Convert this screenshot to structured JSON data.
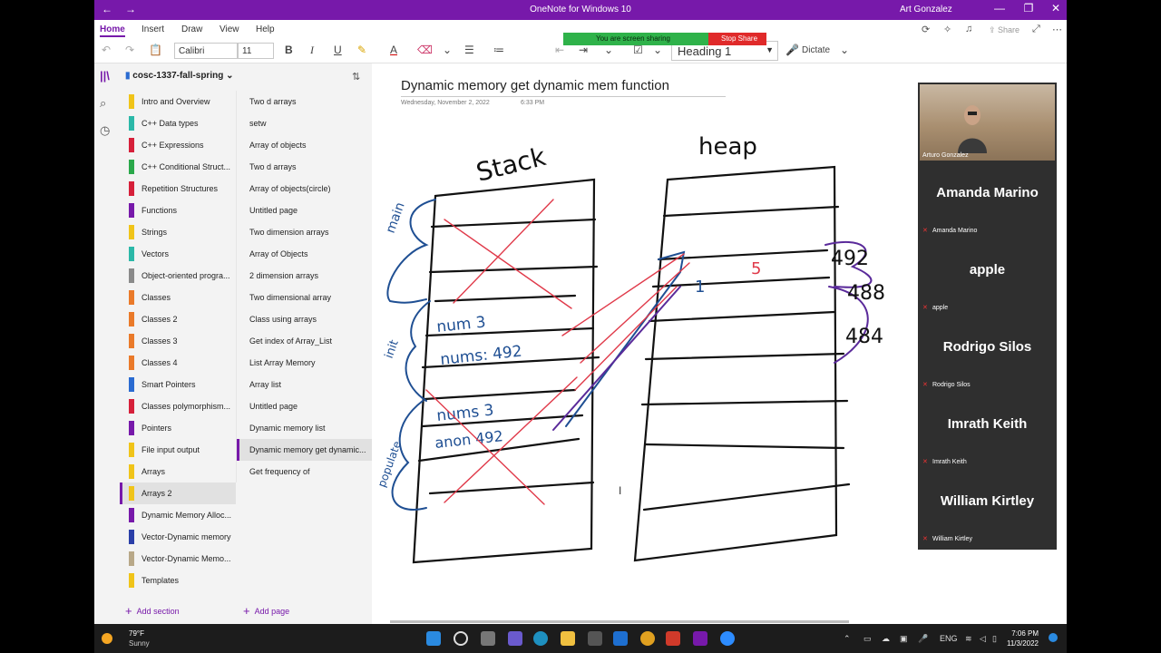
{
  "window": {
    "title": "OneNote for Windows 10",
    "user": "Art Gonzalez",
    "back_glyph": "←",
    "forward_glyph": "→",
    "minimize_glyph": "—",
    "restore_glyph": "❐",
    "close_glyph": "✕"
  },
  "menu": {
    "tabs": [
      "Home",
      "Insert",
      "Draw",
      "View",
      "Help"
    ],
    "active_tab": "Home",
    "share_label": "Share"
  },
  "ribbon": {
    "font_name": "Calibri",
    "font_size": "11",
    "style": "Heading 1",
    "dictate_label": "Dictate"
  },
  "screen_share": {
    "status": "You are screen sharing",
    "stop_label": "Stop Share"
  },
  "notebook": {
    "name": "cosc-1337-fall-spring",
    "sections": [
      {
        "label": "Intro and Overview",
        "color": "#f0c419"
      },
      {
        "label": "C++ Data types",
        "color": "#2bb8a8"
      },
      {
        "label": "C++ Expressions",
        "color": "#d6203a"
      },
      {
        "label": "C++ Conditional Struct...",
        "color": "#2aa84a"
      },
      {
        "label": "Repetition Structures",
        "color": "#d6203a"
      },
      {
        "label": "Functions",
        "color": "#7719aa"
      },
      {
        "label": "Strings",
        "color": "#f0c419"
      },
      {
        "label": "Vectors",
        "color": "#2bb8a8"
      },
      {
        "label": "Object-oriented progra...",
        "color": "#8a8a8a"
      },
      {
        "label": "Classes",
        "color": "#ea7a2a"
      },
      {
        "label": "Classes 2",
        "color": "#ea7a2a"
      },
      {
        "label": "Classes 3",
        "color": "#ea7a2a"
      },
      {
        "label": "Classes 4",
        "color": "#ea7a2a"
      },
      {
        "label": "Smart Pointers",
        "color": "#2a6bd1"
      },
      {
        "label": "Classes polymorphism...",
        "color": "#d6203a"
      },
      {
        "label": "Pointers",
        "color": "#7719aa"
      },
      {
        "label": "File input output",
        "color": "#f0c419"
      },
      {
        "label": "Arrays",
        "color": "#f0c419"
      },
      {
        "label": "Arrays 2",
        "color": "#f0c419"
      },
      {
        "label": "Dynamic Memory Alloc...",
        "color": "#7719aa"
      },
      {
        "label": "Vector-Dynamic memory",
        "color": "#2a3fa8"
      },
      {
        "label": "Vector-Dynamic Memo...",
        "color": "#b8a888"
      },
      {
        "label": "Templates",
        "color": "#f0c419"
      }
    ],
    "selected_section": "Arrays 2",
    "pages": [
      "Two  d arrays",
      "setw",
      "Array of objects",
      "Two d arrays",
      "Array of objects(circle)",
      "Untitled page",
      "Two dimension arrays",
      "Array of Objects",
      "2 dimension arrays",
      "Two dimensional array",
      "Class using arrays",
      "Get index of Array_List",
      "List Array Memory",
      "Array list",
      "Untitled page",
      "Dynamic memory list",
      "Dynamic memory get dynamic...",
      "Get frequency of"
    ],
    "selected_page": "Dynamic memory get dynamic...",
    "add_section_label": "Add section",
    "add_page_label": "Add page"
  },
  "page": {
    "title": "Dynamic memory get dynamic mem function",
    "date": "Wednesday, November 2, 2022",
    "time": "6:33 PM"
  },
  "ink_text": {
    "stack": "Stack",
    "heap": "heap",
    "main": "main",
    "init": "init",
    "populate": "populate",
    "num3": "num 3",
    "nums492": "nums: 492",
    "nums3": "nums 3",
    "anon492": "anon 492",
    "h1": "1",
    "h5": "5",
    "a492": "492",
    "a488": "488",
    "a484": "484"
  },
  "participants": {
    "self_name": "Arturo Gonzalez",
    "others": [
      "Amanda Marino",
      "apple",
      "Rodrigo Silos",
      "Imrath Keith",
      "William Kirtley"
    ]
  },
  "taskbar": {
    "temperature": "79°F",
    "condition": "Sunny",
    "language": "ENG",
    "time": "7:06 PM",
    "date": "11/3/2022"
  }
}
